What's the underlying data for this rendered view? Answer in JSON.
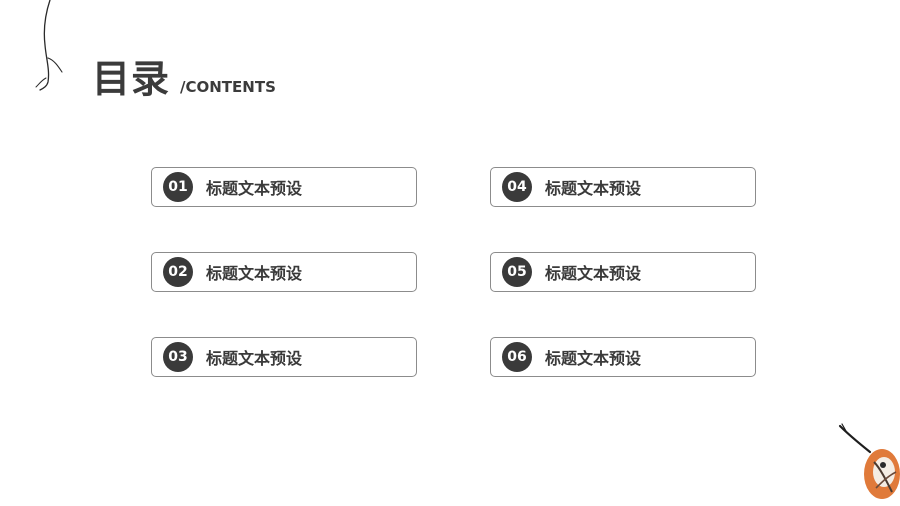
{
  "header": {
    "title": "目录",
    "subtitle": "/CONTENTS"
  },
  "toc": {
    "items": [
      {
        "number": "01",
        "label": "标题文本预设"
      },
      {
        "number": "02",
        "label": "标题文本预设"
      },
      {
        "number": "03",
        "label": "标题文本预设"
      },
      {
        "number": "04",
        "label": "标题文本预设"
      },
      {
        "number": "05",
        "label": "标题文本预设"
      },
      {
        "number": "06",
        "label": "标题文本预设"
      }
    ]
  },
  "decorations": {
    "top_left": "branch-icon",
    "bottom_right": "bird-on-branch-icon",
    "accent_color": "#3a3a3a",
    "bird_color": "#e07a3a"
  }
}
